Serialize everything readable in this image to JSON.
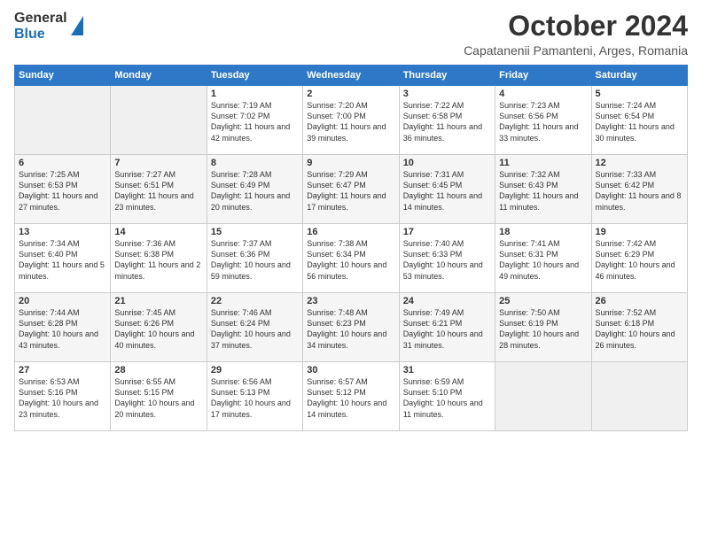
{
  "header": {
    "logo_general": "General",
    "logo_blue": "Blue",
    "month_title": "October 2024",
    "subtitle": "Capatanenii Pamanteni, Arges, Romania"
  },
  "days_of_week": [
    "Sunday",
    "Monday",
    "Tuesday",
    "Wednesday",
    "Thursday",
    "Friday",
    "Saturday"
  ],
  "weeks": [
    [
      {
        "day": "",
        "sunrise": "",
        "sunset": "",
        "daylight": ""
      },
      {
        "day": "",
        "sunrise": "",
        "sunset": "",
        "daylight": ""
      },
      {
        "day": "1",
        "sunrise": "Sunrise: 7:19 AM",
        "sunset": "Sunset: 7:02 PM",
        "daylight": "Daylight: 11 hours and 42 minutes."
      },
      {
        "day": "2",
        "sunrise": "Sunrise: 7:20 AM",
        "sunset": "Sunset: 7:00 PM",
        "daylight": "Daylight: 11 hours and 39 minutes."
      },
      {
        "day": "3",
        "sunrise": "Sunrise: 7:22 AM",
        "sunset": "Sunset: 6:58 PM",
        "daylight": "Daylight: 11 hours and 36 minutes."
      },
      {
        "day": "4",
        "sunrise": "Sunrise: 7:23 AM",
        "sunset": "Sunset: 6:56 PM",
        "daylight": "Daylight: 11 hours and 33 minutes."
      },
      {
        "day": "5",
        "sunrise": "Sunrise: 7:24 AM",
        "sunset": "Sunset: 6:54 PM",
        "daylight": "Daylight: 11 hours and 30 minutes."
      }
    ],
    [
      {
        "day": "6",
        "sunrise": "Sunrise: 7:25 AM",
        "sunset": "Sunset: 6:53 PM",
        "daylight": "Daylight: 11 hours and 27 minutes."
      },
      {
        "day": "7",
        "sunrise": "Sunrise: 7:27 AM",
        "sunset": "Sunset: 6:51 PM",
        "daylight": "Daylight: 11 hours and 23 minutes."
      },
      {
        "day": "8",
        "sunrise": "Sunrise: 7:28 AM",
        "sunset": "Sunset: 6:49 PM",
        "daylight": "Daylight: 11 hours and 20 minutes."
      },
      {
        "day": "9",
        "sunrise": "Sunrise: 7:29 AM",
        "sunset": "Sunset: 6:47 PM",
        "daylight": "Daylight: 11 hours and 17 minutes."
      },
      {
        "day": "10",
        "sunrise": "Sunrise: 7:31 AM",
        "sunset": "Sunset: 6:45 PM",
        "daylight": "Daylight: 11 hours and 14 minutes."
      },
      {
        "day": "11",
        "sunrise": "Sunrise: 7:32 AM",
        "sunset": "Sunset: 6:43 PM",
        "daylight": "Daylight: 11 hours and 11 minutes."
      },
      {
        "day": "12",
        "sunrise": "Sunrise: 7:33 AM",
        "sunset": "Sunset: 6:42 PM",
        "daylight": "Daylight: 11 hours and 8 minutes."
      }
    ],
    [
      {
        "day": "13",
        "sunrise": "Sunrise: 7:34 AM",
        "sunset": "Sunset: 6:40 PM",
        "daylight": "Daylight: 11 hours and 5 minutes."
      },
      {
        "day": "14",
        "sunrise": "Sunrise: 7:36 AM",
        "sunset": "Sunset: 6:38 PM",
        "daylight": "Daylight: 11 hours and 2 minutes."
      },
      {
        "day": "15",
        "sunrise": "Sunrise: 7:37 AM",
        "sunset": "Sunset: 6:36 PM",
        "daylight": "Daylight: 10 hours and 59 minutes."
      },
      {
        "day": "16",
        "sunrise": "Sunrise: 7:38 AM",
        "sunset": "Sunset: 6:34 PM",
        "daylight": "Daylight: 10 hours and 56 minutes."
      },
      {
        "day": "17",
        "sunrise": "Sunrise: 7:40 AM",
        "sunset": "Sunset: 6:33 PM",
        "daylight": "Daylight: 10 hours and 53 minutes."
      },
      {
        "day": "18",
        "sunrise": "Sunrise: 7:41 AM",
        "sunset": "Sunset: 6:31 PM",
        "daylight": "Daylight: 10 hours and 49 minutes."
      },
      {
        "day": "19",
        "sunrise": "Sunrise: 7:42 AM",
        "sunset": "Sunset: 6:29 PM",
        "daylight": "Daylight: 10 hours and 46 minutes."
      }
    ],
    [
      {
        "day": "20",
        "sunrise": "Sunrise: 7:44 AM",
        "sunset": "Sunset: 6:28 PM",
        "daylight": "Daylight: 10 hours and 43 minutes."
      },
      {
        "day": "21",
        "sunrise": "Sunrise: 7:45 AM",
        "sunset": "Sunset: 6:26 PM",
        "daylight": "Daylight: 10 hours and 40 minutes."
      },
      {
        "day": "22",
        "sunrise": "Sunrise: 7:46 AM",
        "sunset": "Sunset: 6:24 PM",
        "daylight": "Daylight: 10 hours and 37 minutes."
      },
      {
        "day": "23",
        "sunrise": "Sunrise: 7:48 AM",
        "sunset": "Sunset: 6:23 PM",
        "daylight": "Daylight: 10 hours and 34 minutes."
      },
      {
        "day": "24",
        "sunrise": "Sunrise: 7:49 AM",
        "sunset": "Sunset: 6:21 PM",
        "daylight": "Daylight: 10 hours and 31 minutes."
      },
      {
        "day": "25",
        "sunrise": "Sunrise: 7:50 AM",
        "sunset": "Sunset: 6:19 PM",
        "daylight": "Daylight: 10 hours and 28 minutes."
      },
      {
        "day": "26",
        "sunrise": "Sunrise: 7:52 AM",
        "sunset": "Sunset: 6:18 PM",
        "daylight": "Daylight: 10 hours and 26 minutes."
      }
    ],
    [
      {
        "day": "27",
        "sunrise": "Sunrise: 6:53 AM",
        "sunset": "Sunset: 5:16 PM",
        "daylight": "Daylight: 10 hours and 23 minutes."
      },
      {
        "day": "28",
        "sunrise": "Sunrise: 6:55 AM",
        "sunset": "Sunset: 5:15 PM",
        "daylight": "Daylight: 10 hours and 20 minutes."
      },
      {
        "day": "29",
        "sunrise": "Sunrise: 6:56 AM",
        "sunset": "Sunset: 5:13 PM",
        "daylight": "Daylight: 10 hours and 17 minutes."
      },
      {
        "day": "30",
        "sunrise": "Sunrise: 6:57 AM",
        "sunset": "Sunset: 5:12 PM",
        "daylight": "Daylight: 10 hours and 14 minutes."
      },
      {
        "day": "31",
        "sunrise": "Sunrise: 6:59 AM",
        "sunset": "Sunset: 5:10 PM",
        "daylight": "Daylight: 10 hours and 11 minutes."
      },
      {
        "day": "",
        "sunrise": "",
        "sunset": "",
        "daylight": ""
      },
      {
        "day": "",
        "sunrise": "",
        "sunset": "",
        "daylight": ""
      }
    ]
  ]
}
